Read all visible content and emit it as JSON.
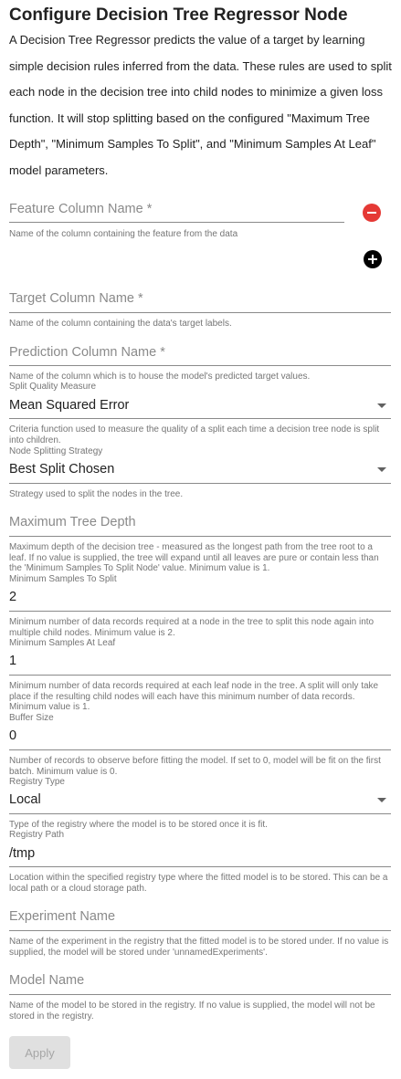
{
  "title": "Configure Decision Tree Regressor Node",
  "description": "A Decision Tree Regressor predicts the value of a target by learning simple decision rules inferred from the data. These rules are used to split each node in the decision tree into child nodes to minimize a given loss function. It will stop splitting based on the configured \"Maximum Tree Depth\", \"Minimum Samples To Split\", and \"Minimum Samples At Leaf\" model parameters.",
  "feature_column": {
    "placeholder": "Feature Column Name *",
    "helper": "Name of the column containing the feature from the data",
    "remove_icon": "minus-circle-icon",
    "add_icon": "plus-circle-icon",
    "remove_color": "#e53935",
    "add_color": "#000000"
  },
  "target_column": {
    "placeholder": "Target Column Name *",
    "helper": "Name of the column containing the data's target labels."
  },
  "prediction_column": {
    "placeholder": "Prediction Column Name *",
    "helper": "Name of the column which is to house the model's predicted target values."
  },
  "split_quality": {
    "label": "Split Quality Measure",
    "value": "Mean Squared Error",
    "helper": "Criteria function used to measure the quality of a split each time a decision tree node is split into children."
  },
  "node_splitting": {
    "label": "Node Splitting Strategy",
    "value": "Best Split Chosen",
    "helper": "Strategy used to split the nodes in the tree."
  },
  "max_tree_depth": {
    "placeholder": "Maximum Tree Depth",
    "helper": "Maximum depth of the decision tree - measured as the longest path from the tree root to a leaf. If no value is supplied, the tree will expand until all leaves are pure or contain less than the 'Minimum Samples To Split Node' value. Minimum value is 1."
  },
  "min_samples_split": {
    "label": "Minimum Samples To Split",
    "value": "2",
    "helper": "Minimum number of data records required at a node in the tree to split this node again into multiple child nodes. Minimum value is 2."
  },
  "min_samples_leaf": {
    "label": "Minimum Samples At Leaf",
    "value": "1",
    "helper": "Minimum number of data records required at each leaf node in the tree. A split will only take place if the resulting child nodes will each have this minimum number of data records. Minimum value is 1."
  },
  "buffer_size": {
    "label": "Buffer Size",
    "value": "0",
    "helper": "Number of records to observe before fitting the model. If set to 0, model will be fit on the first batch. Minimum value is 0."
  },
  "registry_type": {
    "label": "Registry Type",
    "value": "Local",
    "helper": "Type of the registry where the model is to be stored once it is fit."
  },
  "registry_path": {
    "label": "Registry Path",
    "value": "/tmp",
    "helper": "Location within the specified registry type where the fitted model is to be stored. This can be a local path or a cloud storage path."
  },
  "experiment_name": {
    "placeholder": "Experiment Name",
    "helper": "Name of the experiment in the registry that the fitted model is to be stored under. If no value is supplied, the model will be stored under 'unnamedExperiments'."
  },
  "model_name": {
    "placeholder": "Model Name",
    "helper": "Name of the model to be stored in the registry. If no value is supplied, the model will not be stored in the registry."
  },
  "apply_label": "Apply"
}
